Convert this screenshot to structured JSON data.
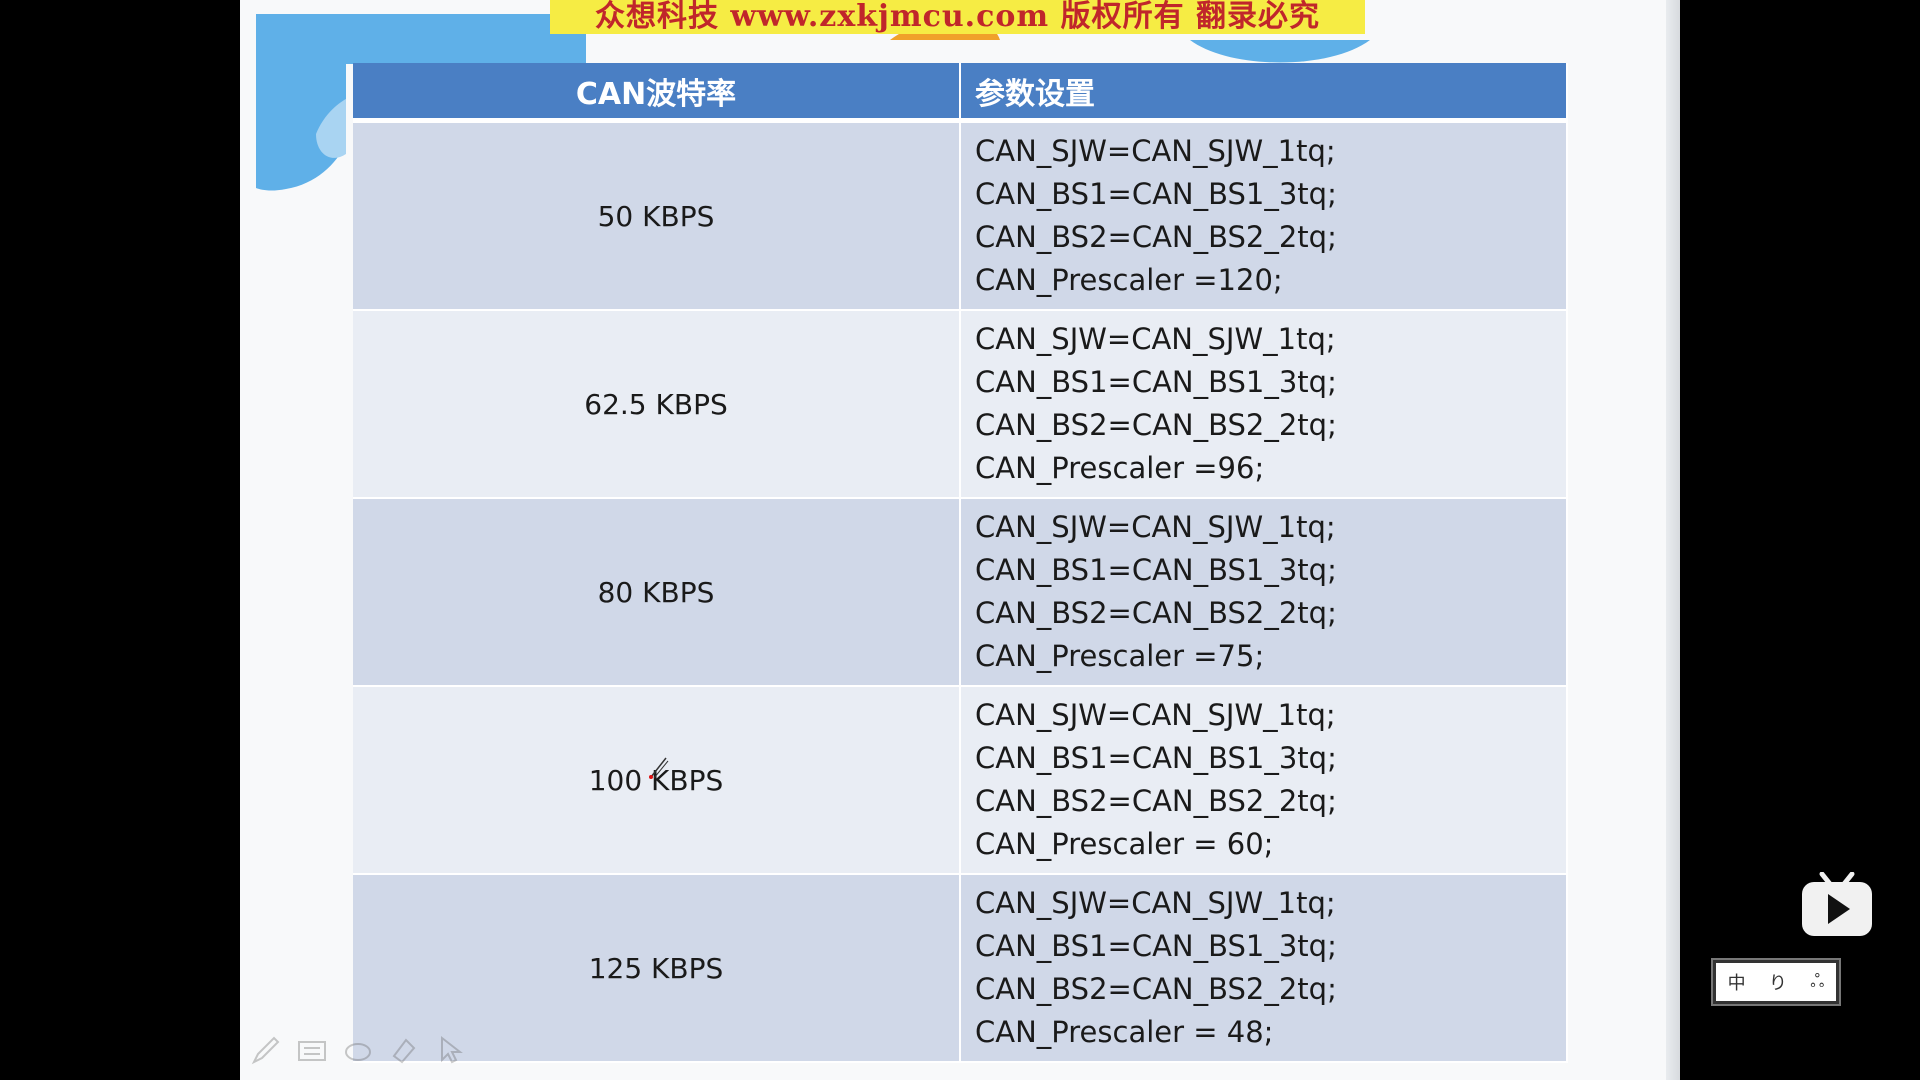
{
  "watermark": "众想科技 www.zxkjmcu.com 版权所有 翻录必究",
  "table": {
    "headers": [
      "CAN波特率",
      "参数设置"
    ],
    "rows": [
      {
        "rate": "50 KBPS",
        "params": [
          "CAN_SJW=CAN_SJW_1tq;",
          "CAN_BS1=CAN_BS1_3tq;",
          "CAN_BS2=CAN_BS2_2tq;",
          "CAN_Prescaler =120;"
        ]
      },
      {
        "rate": "62.5 KBPS",
        "params": [
          "CAN_SJW=CAN_SJW_1tq;",
          "CAN_BS1=CAN_BS1_3tq;",
          "CAN_BS2=CAN_BS2_2tq;",
          "CAN_Prescaler =96;"
        ]
      },
      {
        "rate": "80 KBPS",
        "params": [
          "CAN_SJW=CAN_SJW_1tq;",
          "CAN_BS1=CAN_BS1_3tq;",
          "CAN_BS2=CAN_BS2_2tq;",
          "CAN_Prescaler =75;"
        ]
      },
      {
        "rate": "100 KBPS",
        "params": [
          "CAN_SJW=CAN_SJW_1tq;",
          "CAN_BS1=CAN_BS1_3tq;",
          "CAN_BS2=CAN_BS2_2tq;",
          "CAN_Prescaler = 60;"
        ]
      },
      {
        "rate": "125 KBPS",
        "params": [
          "CAN_SJW=CAN_SJW_1tq;",
          "CAN_BS1=CAN_BS1_3tq;",
          "CAN_BS2=CAN_BS2_2tq;",
          "CAN_Prescaler = 48;"
        ]
      }
    ]
  },
  "ime": [
    "中",
    "り",
    "ஃ"
  ],
  "icons": {
    "toolbar": [
      "pen-icon",
      "keyboard-icon",
      "eraser-icon",
      "highlighter-icon",
      "pointer-icon"
    ],
    "play": "play-icon"
  },
  "colors": {
    "header_bg": "#4a7fc4",
    "row_dark": "#d0d8e8",
    "row_light": "#e9edf4",
    "watermark_bg": "#f6ec44",
    "watermark_text": "#c0262b"
  }
}
